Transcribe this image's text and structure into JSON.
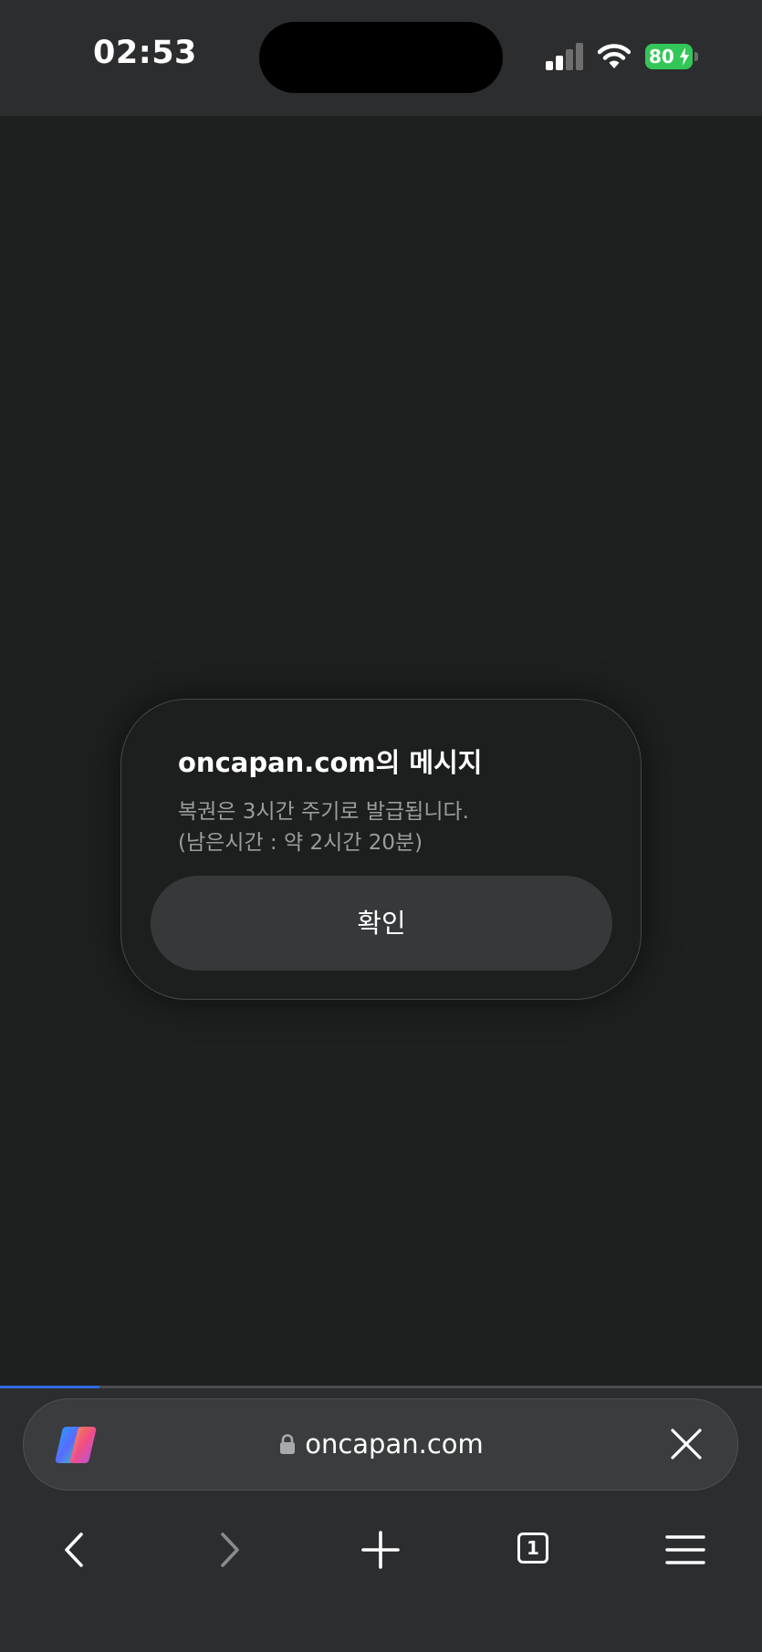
{
  "status_bar": {
    "time": "02:53",
    "battery_level": "80",
    "signal_bars_active": 2,
    "signal_bars_total": 4,
    "icons": [
      "signal-icon",
      "wifi-icon",
      "battery-charging-icon"
    ],
    "battery_color": "#33c759"
  },
  "dialog": {
    "title": "oncapan.com의 메시지",
    "message_lines": [
      "복권은 3시간 주기로 발급됩니다.",
      "(남은시간 : 약 2시간 20분)"
    ],
    "confirm_label": "확인"
  },
  "browser": {
    "url": "oncapan.com",
    "tab_count": "1",
    "page_load_progress": 0.13,
    "progress_color": "#2f6ae0",
    "address_bar_icons": [
      "copilot-icon",
      "lock-icon",
      "close-icon"
    ],
    "toolbar_icons": [
      "back-icon",
      "forward-icon",
      "new-tab-icon",
      "tabs-icon",
      "menu-icon"
    ]
  },
  "colors": {
    "page_background": "#1e1f1f",
    "chrome_background": "#2c2d2e",
    "dialog_button": "#363839",
    "message_text": "#9b9c9e"
  }
}
